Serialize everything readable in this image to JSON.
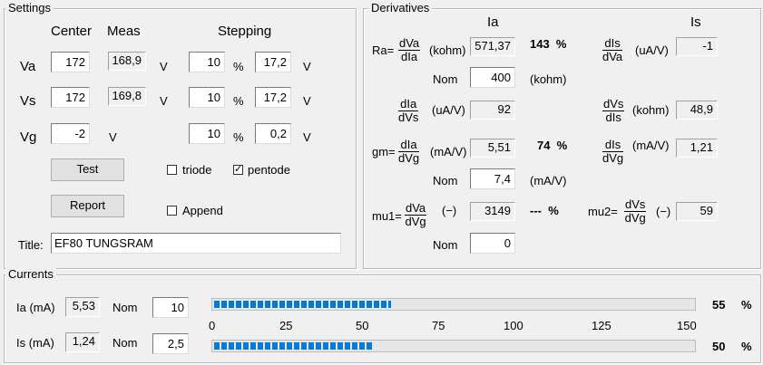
{
  "settings": {
    "title": "Settings",
    "col_center": "Center",
    "col_meas": "Meas",
    "col_stepping": "Stepping",
    "rows": [
      {
        "label": "Va",
        "center": "172",
        "meas": "168,9",
        "unit": "V",
        "step1": "10",
        "step1_unit": "%",
        "step2": "17,2",
        "step2_unit": "V"
      },
      {
        "label": "Vs",
        "center": "172",
        "meas": "169,8",
        "unit": "V",
        "step1": "10",
        "step1_unit": "%",
        "step2": "17,2",
        "step2_unit": "V"
      },
      {
        "label": "Vg",
        "center": "-2",
        "unit": "V",
        "step1": "10",
        "step1_unit": "%",
        "step2": "0,2",
        "step2_unit": "V"
      }
    ],
    "test_button": "Test",
    "report_button": "Report",
    "triode_label": "triode",
    "pentode_label": "pentode",
    "triode_checked": false,
    "pentode_checked": true,
    "append_label": "Append",
    "append_checked": false,
    "title_label": "Title:",
    "title_value": "EF80 TUNGSRAM"
  },
  "derivatives": {
    "title": "Derivatives",
    "col_ia": "Ia",
    "col_is": "Is",
    "ra_label": "Ra=",
    "ra_frac": {
      "num": "dVa",
      "den": "dIa"
    },
    "ra_unit": "(kohm)",
    "ra_value": "571,37",
    "ra_pct": "143  %",
    "dis_dva_frac": {
      "num": "dIs",
      "den": "dVa"
    },
    "dis_dva_unit": "(uA/V)",
    "dis_dva_value": "-1",
    "nom_label": "Nom",
    "ra_nom": "400",
    "ra_nom_unit": "(kohm)",
    "dia_dvs_frac": {
      "num": "dIa",
      "den": "dVs"
    },
    "dia_dvs_unit": "(uA/V)",
    "dia_dvs_value": "92",
    "dvs_dis_frac": {
      "num": "dVs",
      "den": "dIs"
    },
    "dvs_dis_unit": "(kohm)",
    "dvs_dis_value": "48,9",
    "gm_label": "gm=",
    "gm_frac": {
      "num": "dIa",
      "den": "dVg"
    },
    "gm_unit": "(mA/V)",
    "gm_value": "5,51",
    "gm_pct": "74  %",
    "dis_dvg_frac": {
      "num": "dIs",
      "den": "dVg"
    },
    "dis_dvg_unit": "(mA/V)",
    "dis_dvg_value": "1,21",
    "gm_nom": "7,4",
    "gm_nom_unit": "(mA/V)",
    "mu1_label": "mu1=",
    "mu1_frac": {
      "num": "dVa",
      "den": "dVg"
    },
    "mu1_unit": "(−)",
    "mu1_value": "3149",
    "mu1_pct": "---  %",
    "mu2_label": "mu2=",
    "mu2_frac": {
      "num": "dVs",
      "den": "dVg"
    },
    "mu2_unit": "(−)",
    "mu2_value": "59",
    "mu1_nom": "0"
  },
  "currents": {
    "title": "Currents",
    "ia_label": "Ia (mA)",
    "ia_value": "5,53",
    "nom_label": "Nom",
    "ia_nom": "10",
    "ia_pct_value": 55,
    "ia_pct": "55",
    "is_label": "Is (mA)",
    "is_value": "1,24",
    "is_nom": "2,5",
    "is_pct_value": 50,
    "is_pct": "50",
    "pct_unit": "%",
    "scale_ticks": [
      "0",
      "25",
      "50",
      "75",
      "100",
      "125",
      "150"
    ],
    "progress_fill_ratio": [
      0.37,
      0.33
    ]
  },
  "colors": {
    "progress": "#0678d6",
    "background": "#f0f0f0"
  }
}
